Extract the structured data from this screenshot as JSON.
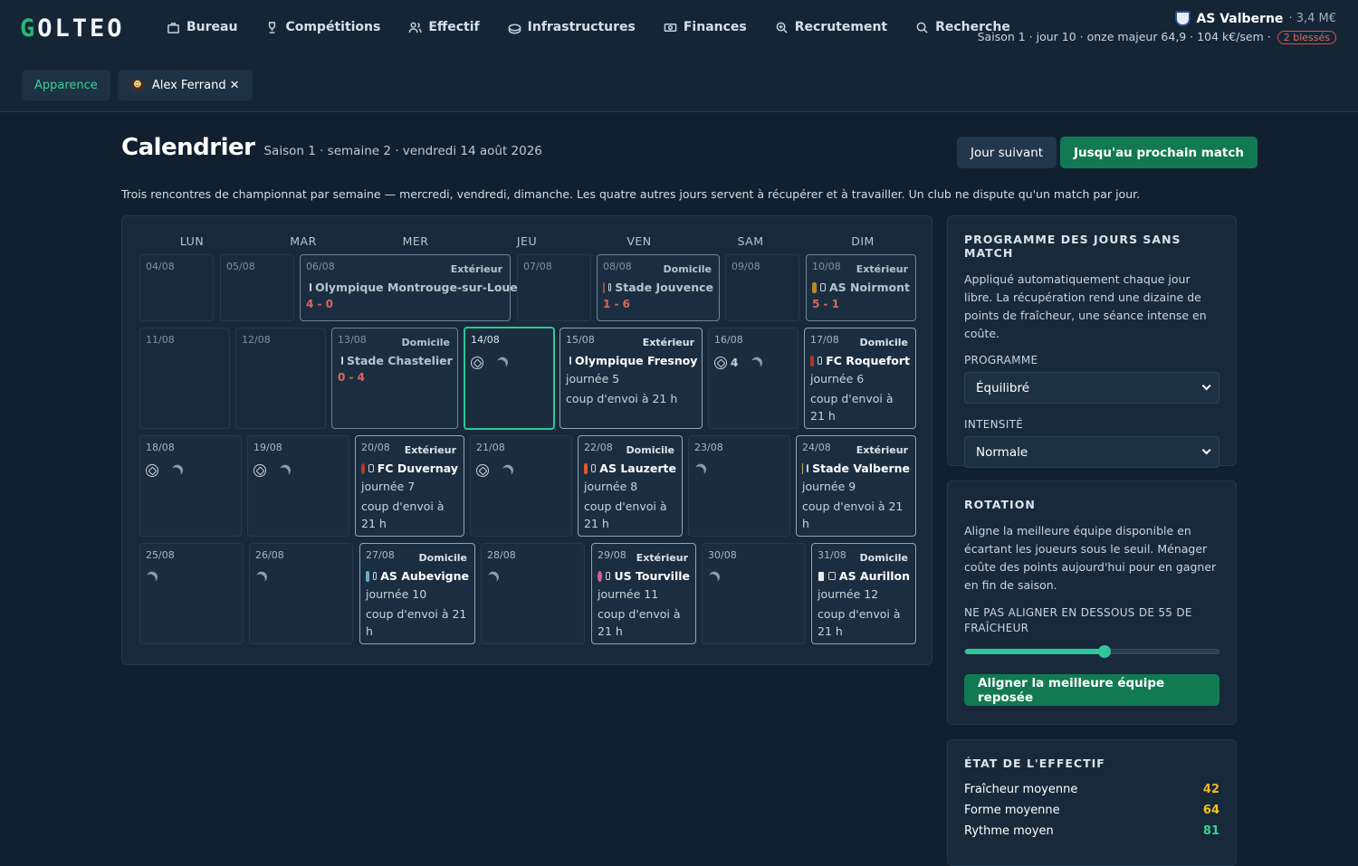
{
  "brand": {
    "logo_first": "G",
    "logo_rest": "OLTEO"
  },
  "nav": [
    {
      "label": "Bureau",
      "icon": "briefcase-icon"
    },
    {
      "label": "Compétitions",
      "icon": "trophy-icon"
    },
    {
      "label": "Effectif",
      "icon": "users-icon"
    },
    {
      "label": "Infrastructures",
      "icon": "stadium-icon"
    },
    {
      "label": "Finances",
      "icon": "banknote-icon"
    },
    {
      "label": "Recrutement",
      "icon": "scout-icon"
    },
    {
      "label": "Recherche",
      "icon": "search-icon"
    }
  ],
  "club": {
    "name": "AS Valberne",
    "budget": "· 3,4 M€",
    "summary": "Saison 1 · jour 10 · onze majeur 64,9 · 104 k€/sem ·",
    "injuries": "2 blessés"
  },
  "subtabs": {
    "appearance": "Apparence",
    "user": "Alex Ferrand",
    "close": "✕"
  },
  "page": {
    "title": "Calendrier",
    "subtitle": "Saison 1 · semaine 2 · vendredi 14 août 2026",
    "next_day": "Jour suivant",
    "to_next_match": "Jusqu'au prochain match"
  },
  "intro": "Trois rencontres de championnat par semaine — mercredi, vendredi, dimanche. Les quatre autres jours servent à récupérer et à travailler. Un club ne dispute qu'un match par jour.",
  "calendar": {
    "weekdays": [
      "LUN",
      "MAR",
      "MER",
      "JEU",
      "VEN",
      "SAM",
      "DIM"
    ],
    "days": {
      "d0408": {
        "date": "04/08"
      },
      "d0508": {
        "date": "05/08"
      },
      "d0608": {
        "date": "06/08",
        "venue": "Extérieur",
        "opponent": "Olympique Montrouge-sur-Loue",
        "score": "4 - 0"
      },
      "d0708": {
        "date": "07/08"
      },
      "d0808": {
        "date": "08/08",
        "venue": "Domicile",
        "opponent": "Stade Jouvence",
        "score": "1 - 6"
      },
      "d0908": {
        "date": "09/08"
      },
      "d1008": {
        "date": "10/08",
        "venue": "Extérieur",
        "opponent": "AS Noirmont",
        "score": "5 - 1"
      },
      "d1108": {
        "date": "11/08"
      },
      "d1208": {
        "date": "12/08"
      },
      "d1308": {
        "date": "13/08",
        "venue": "Domicile",
        "opponent": "Stade Chastelier",
        "score": "0 - 4"
      },
      "d1408": {
        "date": "14/08"
      },
      "d1508": {
        "date": "15/08",
        "venue": "Extérieur",
        "opponent": "Olympique Fresnoy",
        "round": "journée 5",
        "kickoff": "coup d'envoi à 21 h"
      },
      "d1608": {
        "date": "16/08",
        "count": "4"
      },
      "d1708": {
        "date": "17/08",
        "venue": "Domicile",
        "opponent": "FC Roquefort",
        "round": "journée 6",
        "kickoff": "coup d'envoi à 21 h"
      },
      "d1808": {
        "date": "18/08"
      },
      "d1908": {
        "date": "19/08"
      },
      "d2008": {
        "date": "20/08",
        "venue": "Extérieur",
        "opponent": "FC Duvernay",
        "round": "journée 7",
        "kickoff": "coup d'envoi à 21 h"
      },
      "d2108": {
        "date": "21/08"
      },
      "d2208": {
        "date": "22/08",
        "venue": "Domicile",
        "opponent": "AS Lauzerte",
        "round": "journée 8",
        "kickoff": "coup d'envoi à 21 h"
      },
      "d2308": {
        "date": "23/08"
      },
      "d2408": {
        "date": "24/08",
        "venue": "Extérieur",
        "opponent": "Stade Valberne",
        "round": "journée 9",
        "kickoff": "coup d'envoi à 21 h"
      },
      "d2508": {
        "date": "25/08"
      },
      "d2608": {
        "date": "26/08"
      },
      "d2708": {
        "date": "27/08",
        "venue": "Domicile",
        "opponent": "AS Aubevigne",
        "round": "journée 10",
        "kickoff": "coup d'envoi à 21 h"
      },
      "d2808": {
        "date": "28/08"
      },
      "d2908": {
        "date": "29/08",
        "venue": "Extérieur",
        "opponent": "US Tourville",
        "round": "journée 11",
        "kickoff": "coup d'envoi à 21 h"
      },
      "d3008": {
        "date": "30/08"
      },
      "d3108": {
        "date": "31/08",
        "venue": "Domicile",
        "opponent": "AS Aurillon",
        "round": "journée 12",
        "kickoff": "coup d'envoi à 21 h"
      }
    }
  },
  "program_panel": {
    "title": "PROGRAMME DES JOURS SANS MATCH",
    "text": "Appliqué automatiquement chaque jour libre. La récupération rend une dizaine de points de fraîcheur, une séance intense en coûte.",
    "program_label": "PROGRAMME",
    "program_value": "Équilibré",
    "intensity_label": "INTENSITÉ",
    "intensity_value": "Normale"
  },
  "rotation_panel": {
    "title": "ROTATION",
    "text": "Aligne la meilleure équipe disponible en écartant les joueurs sous le seuil. Ménager coûte des points aujourd'hui pour en gagner en fin de saison.",
    "threshold_label": "NE PAS ALIGNER EN DESSOUS DE 55 DE FRAÎCHEUR",
    "threshold_value": 55,
    "button": "Aligner la meilleure équipe reposée"
  },
  "squad_panel": {
    "title": "ÉTAT DE L'EFFECTIF",
    "stats": [
      {
        "label": "Fraîcheur moyenne",
        "value": "42",
        "color": "#f0b429"
      },
      {
        "label": "Forme moyenne",
        "value": "64",
        "color": "#f0c419"
      },
      {
        "label": "Rythme moyen",
        "value": "81",
        "color": "#3fcf8e"
      }
    ]
  }
}
